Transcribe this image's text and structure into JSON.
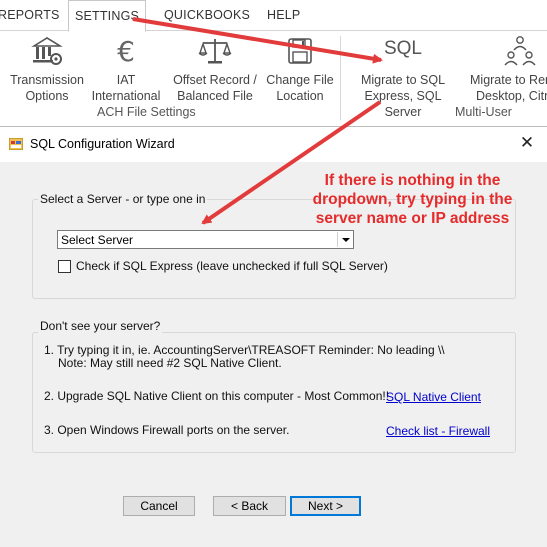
{
  "ribbon": {
    "tabs": [
      {
        "label": "REPORTS"
      },
      {
        "label": "SETTINGS",
        "active": true
      },
      {
        "label": "QUICKBOOKS"
      },
      {
        "label": "HELP"
      }
    ],
    "buttons": {
      "transmission": {
        "line1": "Transmission",
        "line2": "Options"
      },
      "iat": {
        "line1": "IAT",
        "line2": "International"
      },
      "offset": {
        "line1": "Offset Record /",
        "line2": "Balanced File"
      },
      "change_file": {
        "line1": "Change File",
        "line2": "Location"
      },
      "migrate_sql": {
        "line1": "Migrate to SQL",
        "line2": "Express, SQL Server",
        "icon_text": "SQL"
      },
      "migrate_rem": {
        "line1": "Migrate to Rem",
        "line2": "Desktop, Citr"
      }
    },
    "groups": {
      "ach": "ACH File Settings",
      "multi_user": "Multi-User"
    }
  },
  "dialog": {
    "title": "SQL Configuration Wizard",
    "close_glyph": "✕",
    "server_group": {
      "label": "Select a Server - or type one in",
      "combo_value": "Select Server",
      "checkbox_label": "Check if SQL Express (leave unchecked if full SQL Server)"
    },
    "help_group": {
      "label": "Don't see your server?",
      "item1_line1": "1. Try typing it in, ie. AccountingServer\\TREASOFT  Reminder: No leading \\\\",
      "item1_line2": "Note: May still need #2 SQL Native Client.",
      "item2": "2. Upgrade SQL Native Client on this computer - Most Common!!",
      "item2_link": "SQL Native Client",
      "item3": "3. Open Windows Firewall ports on the server.",
      "item3_link": "Check list - Firewall"
    },
    "buttons": {
      "cancel": "Cancel",
      "back": "< Back",
      "next": "Next >"
    }
  },
  "annotation": {
    "text": "If there is nothing in the dropdown, try typing in the server name or IP address",
    "color": "#e52b2b"
  },
  "colors": {
    "accent_arrow": "#e23b3b",
    "link": "#0000cc",
    "default_button_border": "#0078d7"
  }
}
